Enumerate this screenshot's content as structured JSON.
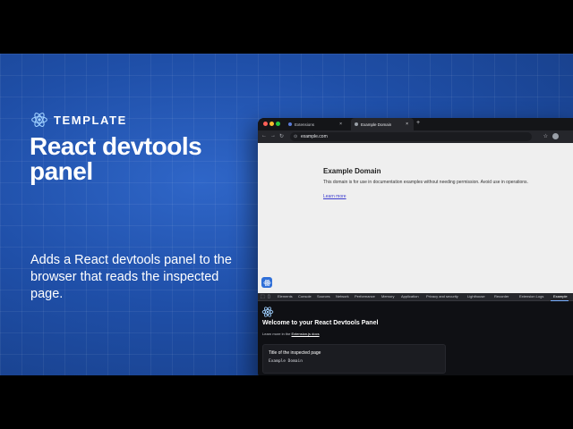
{
  "hero": {
    "tag": "TEMPLATE",
    "title": "React devtools panel",
    "description": "Adds a React devtools panel to the browser that reads the inspected page."
  },
  "browser": {
    "tabs": [
      {
        "label": "Extensions"
      },
      {
        "label": "Example Domain"
      }
    ],
    "new_tab": "+",
    "url": "example.com",
    "page": {
      "heading": "Example Domain",
      "body": "This domain is for use in documentation examples without needing permission. Avoid use in operations.",
      "link": "Learn more"
    },
    "devtools": {
      "tabs": [
        "Elements",
        "Console",
        "Sources",
        "Network",
        "Performance",
        "Memory",
        "Application",
        "Privacy and security",
        "Lighthouse",
        "Recorder",
        "Extension Logs",
        "Example"
      ],
      "active_tab": "Example"
    },
    "panel": {
      "title": "Welcome to your React Devtools Panel",
      "sub_prefix": "Learn more in the",
      "sub_link": "Extension.js docs",
      "card_label": "Title of the inspected page",
      "card_value": "Example Domain"
    }
  },
  "colors": {
    "accent": "#2f6fd8",
    "hero_bg": "#1f4fa8"
  }
}
